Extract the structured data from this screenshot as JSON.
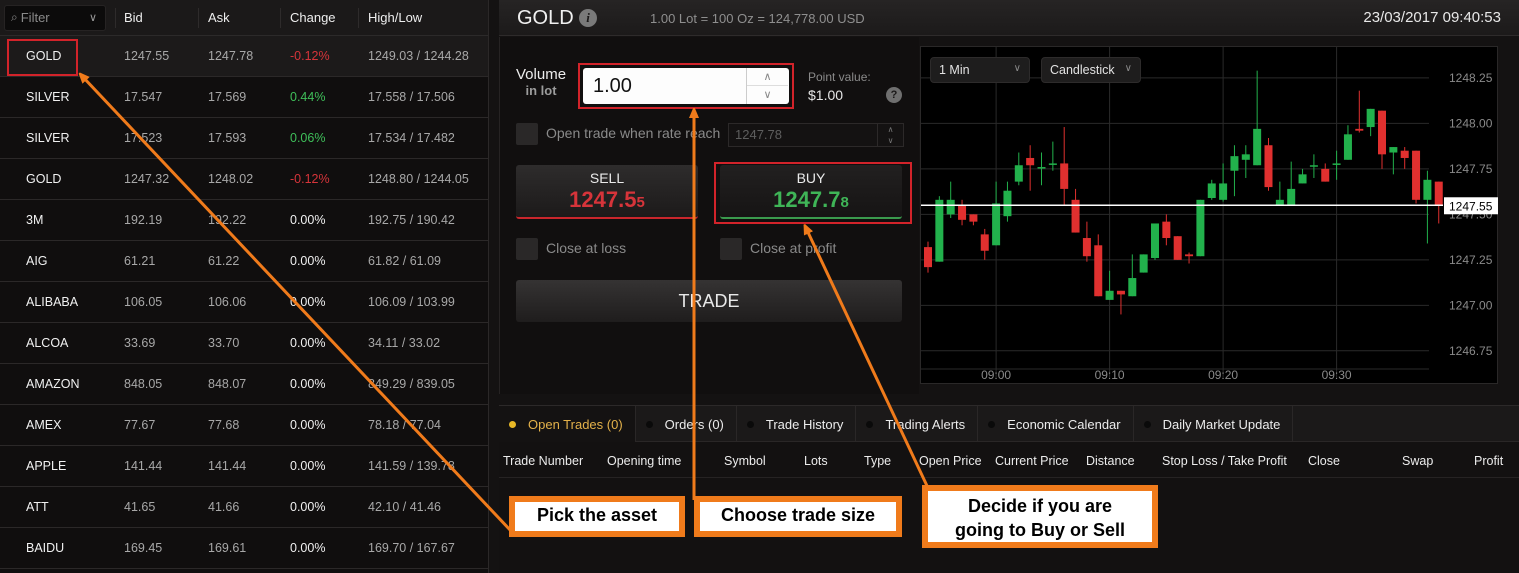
{
  "asset_list": {
    "filter_placeholder": "Filter",
    "columns": [
      "Bid",
      "Ask",
      "Change",
      "High/Low"
    ],
    "rows": [
      {
        "name": "GOLD",
        "bid": "1247.55",
        "ask": "1247.78",
        "change": "-0.12%",
        "dir": "neg",
        "high_low": "1249.03 / 1244.28",
        "selected": true
      },
      {
        "name": "SILVER",
        "bid": "17.547",
        "ask": "17.569",
        "change": "0.44%",
        "dir": "pos",
        "high_low": "17.558 / 17.506"
      },
      {
        "name": "SILVER",
        "bid": "17.523",
        "ask": "17.593",
        "change": "0.06%",
        "dir": "pos",
        "high_low": "17.534 / 17.482"
      },
      {
        "name": "GOLD",
        "bid": "1247.32",
        "ask": "1248.02",
        "change": "-0.12%",
        "dir": "neg",
        "high_low": "1248.80 / 1244.05"
      },
      {
        "name": "3M",
        "bid": "192.19",
        "ask": "192.22",
        "change": "0.00%",
        "dir": "flat",
        "high_low": "192.75 / 190.42"
      },
      {
        "name": "AIG",
        "bid": "61.21",
        "ask": "61.22",
        "change": "0.00%",
        "dir": "flat",
        "high_low": "61.82 / 61.09"
      },
      {
        "name": "ALIBABA",
        "bid": "106.05",
        "ask": "106.06",
        "change": "0.00%",
        "dir": "flat",
        "high_low": "106.09 / 103.99"
      },
      {
        "name": "ALCOA",
        "bid": "33.69",
        "ask": "33.70",
        "change": "0.00%",
        "dir": "flat",
        "high_low": "34.11 / 33.02"
      },
      {
        "name": "AMAZON",
        "bid": "848.05",
        "ask": "848.07",
        "change": "0.00%",
        "dir": "flat",
        "high_low": "849.29 / 839.05"
      },
      {
        "name": "AMEX",
        "bid": "77.67",
        "ask": "77.68",
        "change": "0.00%",
        "dir": "flat",
        "high_low": "78.18 / 77.04"
      },
      {
        "name": "APPLE",
        "bid": "141.44",
        "ask": "141.44",
        "change": "0.00%",
        "dir": "flat",
        "high_low": "141.59 / 139.78"
      },
      {
        "name": "ATT",
        "bid": "41.65",
        "ask": "41.66",
        "change": "0.00%",
        "dir": "flat",
        "high_low": "42.10 / 41.46"
      },
      {
        "name": "BAIDU",
        "bid": "169.45",
        "ask": "169.61",
        "change": "0.00%",
        "dir": "flat",
        "high_low": "169.70 / 167.67"
      }
    ]
  },
  "topbar": {
    "asset": "GOLD",
    "lot_info": "1.00 Lot = 100 Oz = 124,778.00 USD",
    "datetime": "23/03/2017 09:40:53"
  },
  "trade": {
    "volume_label": "Volume",
    "volume_sub": "in lot",
    "volume_value": "1.00",
    "point_value_label": "Point value:",
    "point_value": "$1.00",
    "open_when_label": "Open trade when rate reach",
    "open_when_value": "1247.78",
    "sell_label": "SELL",
    "sell_price_main": "1247.5",
    "sell_price_pip": "5",
    "buy_label": "BUY",
    "buy_price_main": "1247.7",
    "buy_price_pip": "8",
    "close_loss_label": "Close at loss",
    "close_profit_label": "Close at profit",
    "trade_label": "TRADE"
  },
  "chart_controls": {
    "interval": "1 Min",
    "chart_type": "Candlestick"
  },
  "chart_data": {
    "type": "candlestick",
    "title": "",
    "xlabel": "",
    "ylabel": "",
    "ylim": [
      1246.65,
      1248.42
    ],
    "yticks": [
      "1248.25",
      "1248.00",
      "1247.75",
      "1247.50",
      "1247.25",
      "1247.00",
      "1246.75"
    ],
    "ytick_values": [
      1248.25,
      1248.0,
      1247.75,
      1247.5,
      1247.25,
      1247.0,
      1246.75
    ],
    "xticks": [
      "09:00",
      "09:10",
      "09:20",
      "09:30"
    ],
    "xtick_index": [
      6,
      16,
      26,
      36
    ],
    "grid": true,
    "current_price": 1247.55,
    "current_price_label": "1247.55",
    "up_color": "#22b14c",
    "down_color": "#e0302f",
    "candles": [
      {
        "t": "08:54",
        "o": 1247.32,
        "h": 1247.35,
        "l": 1247.18,
        "c": 1247.21
      },
      {
        "t": "08:55",
        "o": 1247.24,
        "h": 1247.6,
        "l": 1247.24,
        "c": 1247.58
      },
      {
        "t": "08:56",
        "o": 1247.5,
        "h": 1247.68,
        "l": 1247.48,
        "c": 1247.58
      },
      {
        "t": "08:57",
        "o": 1247.55,
        "h": 1247.58,
        "l": 1247.44,
        "c": 1247.47
      },
      {
        "t": "08:58",
        "o": 1247.5,
        "h": 1247.5,
        "l": 1247.44,
        "c": 1247.46
      },
      {
        "t": "08:59",
        "o": 1247.39,
        "h": 1247.42,
        "l": 1247.25,
        "c": 1247.3
      },
      {
        "t": "09:00",
        "o": 1247.33,
        "h": 1247.68,
        "l": 1247.33,
        "c": 1247.56
      },
      {
        "t": "09:01",
        "o": 1247.49,
        "h": 1247.68,
        "l": 1247.46,
        "c": 1247.63
      },
      {
        "t": "09:02",
        "o": 1247.68,
        "h": 1247.84,
        "l": 1247.66,
        "c": 1247.77
      },
      {
        "t": "09:03",
        "o": 1247.81,
        "h": 1247.88,
        "l": 1247.63,
        "c": 1247.77
      },
      {
        "t": "09:04",
        "o": 1247.76,
        "h": 1247.84,
        "l": 1247.66,
        "c": 1247.76
      },
      {
        "t": "09:05",
        "o": 1247.78,
        "h": 1247.9,
        "l": 1247.74,
        "c": 1247.78
      },
      {
        "t": "09:06",
        "o": 1247.78,
        "h": 1247.98,
        "l": 1247.55,
        "c": 1247.64
      },
      {
        "t": "09:07",
        "o": 1247.58,
        "h": 1247.64,
        "l": 1247.4,
        "c": 1247.4
      },
      {
        "t": "09:08",
        "o": 1247.37,
        "h": 1247.46,
        "l": 1247.24,
        "c": 1247.27
      },
      {
        "t": "09:09",
        "o": 1247.33,
        "h": 1247.39,
        "l": 1247.05,
        "c": 1247.05
      },
      {
        "t": "09:10",
        "o": 1247.03,
        "h": 1247.19,
        "l": 1247.03,
        "c": 1247.08
      },
      {
        "t": "09:11",
        "o": 1247.08,
        "h": 1247.08,
        "l": 1246.95,
        "c": 1247.06
      },
      {
        "t": "09:12",
        "o": 1247.05,
        "h": 1247.28,
        "l": 1247.05,
        "c": 1247.15
      },
      {
        "t": "09:13",
        "o": 1247.18,
        "h": 1247.28,
        "l": 1247.18,
        "c": 1247.28
      },
      {
        "t": "09:14",
        "o": 1247.26,
        "h": 1247.45,
        "l": 1247.25,
        "c": 1247.45
      },
      {
        "t": "09:15",
        "o": 1247.46,
        "h": 1247.5,
        "l": 1247.33,
        "c": 1247.37
      },
      {
        "t": "09:16",
        "o": 1247.38,
        "h": 1247.38,
        "l": 1247.25,
        "c": 1247.25
      },
      {
        "t": "09:17",
        "o": 1247.28,
        "h": 1247.29,
        "l": 1247.23,
        "c": 1247.27
      },
      {
        "t": "09:18",
        "o": 1247.27,
        "h": 1247.58,
        "l": 1247.27,
        "c": 1247.58
      },
      {
        "t": "09:19",
        "o": 1247.59,
        "h": 1247.69,
        "l": 1247.58,
        "c": 1247.67
      },
      {
        "t": "09:20",
        "o": 1247.58,
        "h": 1247.78,
        "l": 1247.57,
        "c": 1247.67
      },
      {
        "t": "09:21",
        "o": 1247.74,
        "h": 1247.88,
        "l": 1247.6,
        "c": 1247.82
      },
      {
        "t": "09:22",
        "o": 1247.8,
        "h": 1247.88,
        "l": 1247.7,
        "c": 1247.83
      },
      {
        "t": "09:23",
        "o": 1247.77,
        "h": 1248.29,
        "l": 1247.77,
        "c": 1247.97
      },
      {
        "t": "09:24",
        "o": 1247.88,
        "h": 1247.92,
        "l": 1247.63,
        "c": 1247.65
      },
      {
        "t": "09:25",
        "o": 1247.55,
        "h": 1247.68,
        "l": 1247.55,
        "c": 1247.58
      },
      {
        "t": "09:26",
        "o": 1247.55,
        "h": 1247.79,
        "l": 1247.55,
        "c": 1247.64
      },
      {
        "t": "09:27",
        "o": 1247.67,
        "h": 1247.75,
        "l": 1247.67,
        "c": 1247.72
      },
      {
        "t": "09:28",
        "o": 1247.77,
        "h": 1247.83,
        "l": 1247.7,
        "c": 1247.77
      },
      {
        "t": "09:29",
        "o": 1247.75,
        "h": 1247.78,
        "l": 1247.68,
        "c": 1247.68
      },
      {
        "t": "09:30",
        "o": 1247.78,
        "h": 1247.85,
        "l": 1247.69,
        "c": 1247.78
      },
      {
        "t": "09:31",
        "o": 1247.8,
        "h": 1247.99,
        "l": 1247.8,
        "c": 1247.94
      },
      {
        "t": "09:32",
        "o": 1247.97,
        "h": 1248.18,
        "l": 1247.95,
        "c": 1247.96
      },
      {
        "t": "09:33",
        "o": 1247.98,
        "h": 1248.08,
        "l": 1247.93,
        "c": 1248.08
      },
      {
        "t": "09:34",
        "o": 1248.07,
        "h": 1248.07,
        "l": 1247.75,
        "c": 1247.83
      },
      {
        "t": "09:35",
        "o": 1247.84,
        "h": 1247.87,
        "l": 1247.72,
        "c": 1247.87
      },
      {
        "t": "09:36",
        "o": 1247.85,
        "h": 1247.87,
        "l": 1247.75,
        "c": 1247.81
      },
      {
        "t": "09:37",
        "o": 1247.85,
        "h": 1247.85,
        "l": 1247.56,
        "c": 1247.58
      },
      {
        "t": "09:38",
        "o": 1247.58,
        "h": 1247.74,
        "l": 1247.34,
        "c": 1247.69
      },
      {
        "t": "09:39",
        "o": 1247.68,
        "h": 1247.68,
        "l": 1247.45,
        "c": 1247.55
      }
    ]
  },
  "bottom": {
    "tabs": [
      {
        "label": "Open Trades (0)",
        "active": true
      },
      {
        "label": "Orders (0)"
      },
      {
        "label": "Trade History"
      },
      {
        "label": "Trading Alerts"
      },
      {
        "label": "Economic Calendar"
      },
      {
        "label": "Daily Market Update"
      }
    ],
    "columns": [
      "Trade Number",
      "Opening time",
      "Symbol",
      "Lots",
      "Type",
      "Open Price",
      "Current Price",
      "Distance",
      "Stop Loss / Take Profit",
      "Close",
      "Swap",
      "Profit"
    ]
  },
  "annotations": {
    "pick_asset": "Pick the asset",
    "trade_size": "Choose trade size",
    "buy_sell_line1": "Decide if you are",
    "buy_sell_line2": "going to Buy or Sell",
    "arrow_color": "#f07b1b",
    "highlight_color": "#d2232a"
  }
}
